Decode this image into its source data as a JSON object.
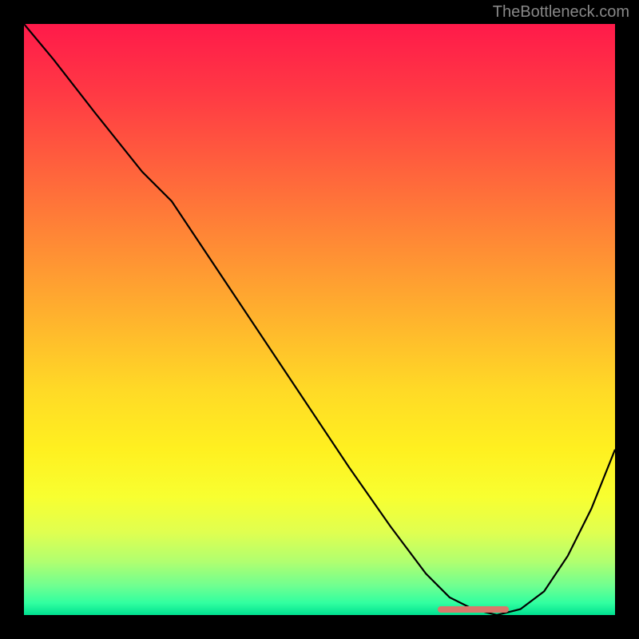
{
  "watermark": "TheBottleneck.com",
  "chart_data": {
    "type": "line",
    "title": "",
    "xlabel": "",
    "ylabel": "",
    "xlim": [
      0,
      100
    ],
    "ylim": [
      0,
      100
    ],
    "x": [
      0,
      5,
      12,
      20,
      25,
      35,
      45,
      55,
      62,
      68,
      72,
      76,
      80,
      84,
      88,
      92,
      96,
      100
    ],
    "y": [
      100,
      94,
      85,
      75,
      70,
      55,
      40,
      25,
      15,
      7,
      3,
      1,
      0,
      1,
      4,
      10,
      18,
      28
    ],
    "optimum_marker": {
      "x_start": 70,
      "x_end": 82,
      "y": 1,
      "color": "#d9786b"
    },
    "background": "red-yellow-green vertical gradient",
    "note": "Black V-shaped bottleneck curve over gradient; minimum near x≈79."
  }
}
